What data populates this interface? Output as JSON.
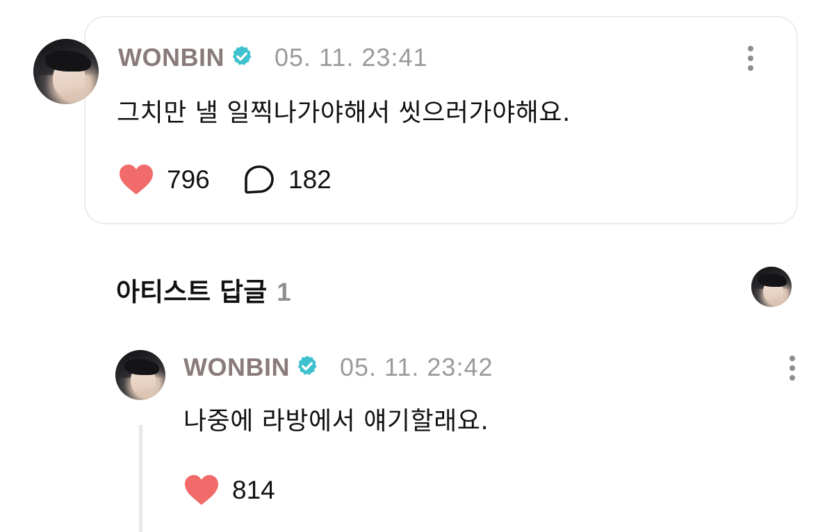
{
  "post": {
    "author": "WONBIN",
    "timestamp": "05. 11. 23:41",
    "text": "그치만 낼 일찍나가야해서 씻으러가야해요.",
    "like_count": "796",
    "comment_count": "182"
  },
  "artist_replies": {
    "title": "아티스트 답글",
    "count": "1"
  },
  "reply": {
    "author": "WONBIN",
    "timestamp": "05. 11. 23:42",
    "text": "나중에 라방에서 얘기할래요.",
    "like_count": "814"
  },
  "icons": {
    "verified": "verified-badge-icon",
    "like": "heart-icon",
    "comment": "speech-bubble-icon",
    "more": "more-vertical-icon"
  },
  "colors": {
    "author": "#8a7b7b",
    "verified": "#3fc1cf",
    "heart": "#f26b6b",
    "timestamp": "#9a9a9a",
    "card_border": "#ececec"
  }
}
